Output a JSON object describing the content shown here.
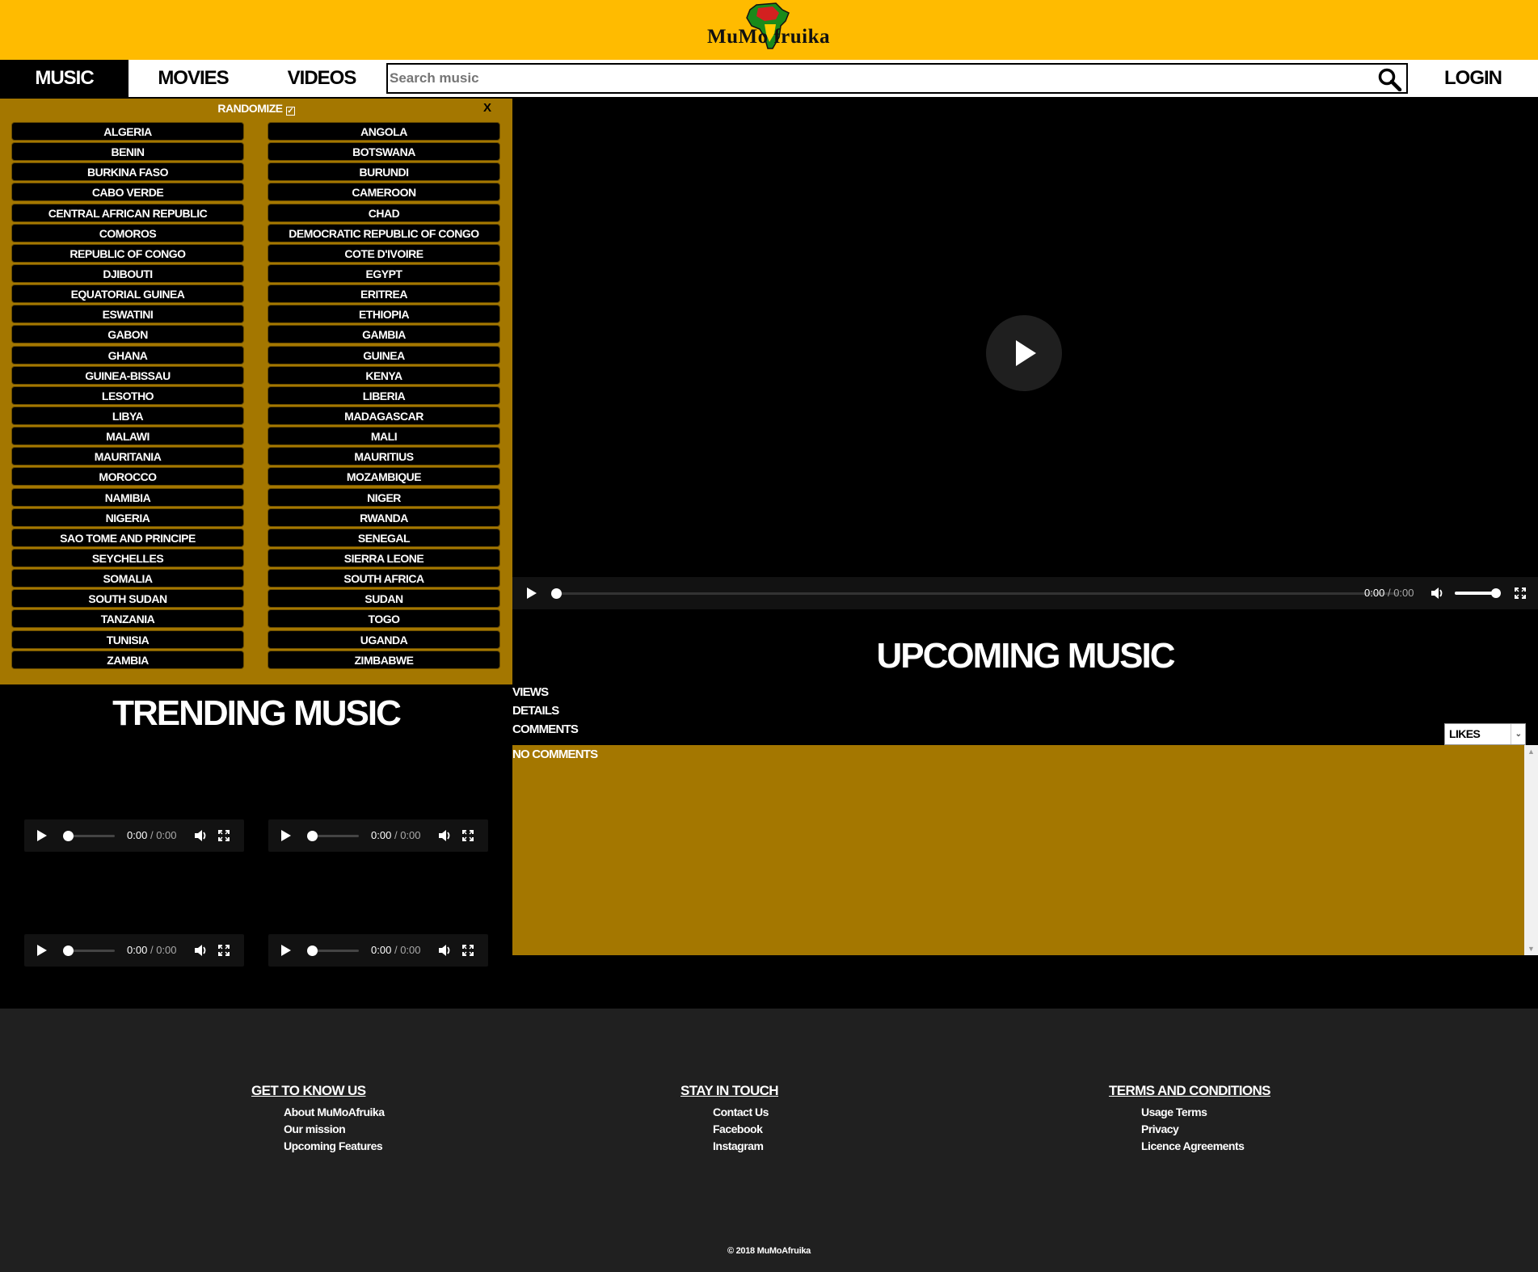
{
  "header": {
    "logo_text": "MuMo fruika"
  },
  "nav": {
    "tabs": [
      "MUSIC",
      "MOVIES",
      "VIDEOS"
    ],
    "search_placeholder": "Search music",
    "login": "LOGIN"
  },
  "panel": {
    "randomize": "RANDOMIZE",
    "close": "X",
    "left_countries": [
      "ALGERIA",
      "BENIN",
      "BURKINA FASO",
      "CABO VERDE",
      "CENTRAL AFRICAN REPUBLIC",
      "COMOROS",
      "REPUBLIC OF CONGO",
      "DJIBOUTI",
      "EQUATORIAL GUINEA",
      "ESWATINI",
      "GABON",
      "GHANA",
      "GUINEA-BISSAU",
      "LESOTHO",
      "LIBYA",
      "MALAWI",
      "MAURITANIA",
      "MOROCCO",
      "NAMIBIA",
      "NIGERIA",
      "SAO TOME AND PRINCIPE",
      "SEYCHELLES",
      "SOMALIA",
      "SOUTH SUDAN",
      "TANZANIA",
      "TUNISIA",
      "ZAMBIA"
    ],
    "right_countries": [
      "ANGOLA",
      "BOTSWANA",
      "BURUNDI",
      "CAMEROON",
      "CHAD",
      "DEMOCRATIC REPUBLIC OF CONGO",
      "COTE D'IVOIRE",
      "EGYPT",
      "ERITREA",
      "ETHIOPIA",
      "GAMBIA",
      "GUINEA",
      "KENYA",
      "LIBERIA",
      "MADAGASCAR",
      "MALI",
      "MAURITIUS",
      "MOZAMBIQUE",
      "NIGER",
      "RWANDA",
      "SENEGAL",
      "SIERRA LEONE",
      "SOUTH AFRICA",
      "SUDAN",
      "TOGO",
      "UGANDA",
      "ZIMBABWE"
    ]
  },
  "trending": {
    "title": "TRENDING MUSIC"
  },
  "player": {
    "current": "0:00",
    "duration": "0:00",
    "separator": "/"
  },
  "upcoming": {
    "title": "UPCOMING MUSIC",
    "links": [
      "VIEWS",
      "DETAILS",
      "COMMENTS"
    ],
    "sort_selected": "LIKES",
    "no_comments": "NO COMMENTS"
  },
  "footer": {
    "columns": [
      {
        "heading": "GET TO KNOW US",
        "links": [
          "About MuMoAfruika",
          "Our mission",
          "Upcoming Features"
        ]
      },
      {
        "heading": "STAY IN TOUCH",
        "links": [
          "Contact Us",
          "Facebook",
          "Instagram"
        ]
      },
      {
        "heading": "TERMS AND CONDITIONS",
        "links": [
          "Usage Terms",
          "Privacy",
          "Licence Agreements"
        ]
      }
    ],
    "copyright": "© 2018 MuMoAfruika"
  },
  "colors": {
    "banner": "#FFBB00",
    "panel": "#A47700",
    "footer": "#202020"
  }
}
